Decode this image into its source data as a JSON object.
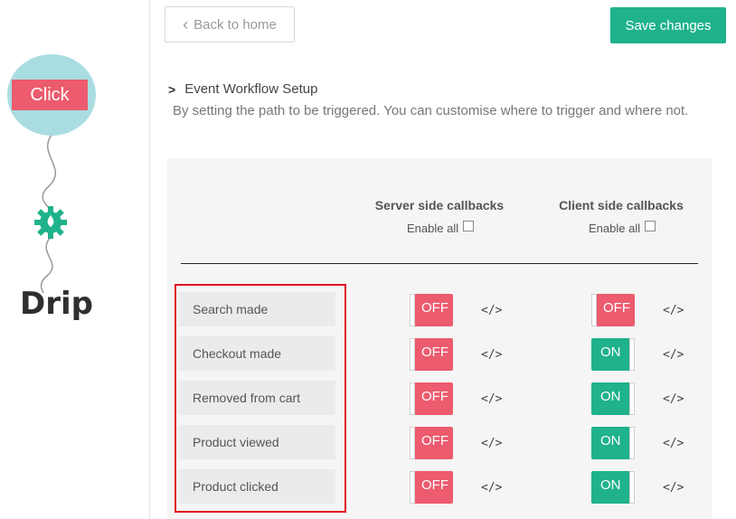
{
  "sidebar": {
    "badge_text": "Click",
    "logo_text": "Drip"
  },
  "toolbar": {
    "back_label": "Back to home",
    "save_label": "Save changes"
  },
  "section": {
    "title": "Event Workflow Setup",
    "description": "By setting the path to be triggered. You can customise where to trigger and where not."
  },
  "columns": {
    "server": {
      "title": "Server side callbacks",
      "enable_all": "Enable all"
    },
    "client": {
      "title": "Client side callbacks",
      "enable_all": "Enable all"
    }
  },
  "events": [
    {
      "label": "Search made",
      "server": "OFF",
      "client": "OFF"
    },
    {
      "label": "Checkout made",
      "server": "OFF",
      "client": "ON"
    },
    {
      "label": "Removed from cart",
      "server": "OFF",
      "client": "ON"
    },
    {
      "label": "Product viewed",
      "server": "OFF",
      "client": "ON"
    },
    {
      "label": "Product clicked",
      "server": "OFF",
      "client": "ON"
    }
  ],
  "code_icon": "</>",
  "colors": {
    "on": "#1fb28b",
    "off": "#ec5b6e",
    "highlight": "#e0141e"
  }
}
